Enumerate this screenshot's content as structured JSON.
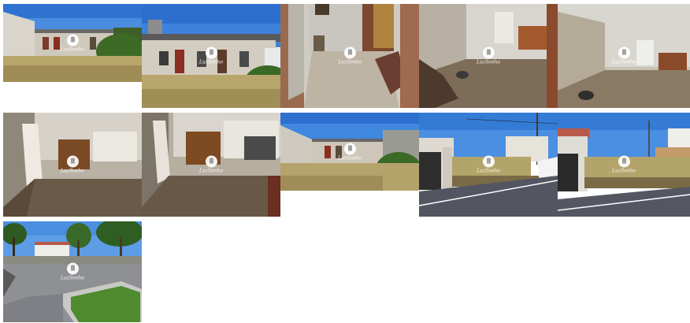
{
  "gallery": {
    "watermark": "LuzSonho",
    "photos": [
      {
        "scene": "exterior-low-building-garden"
      },
      {
        "scene": "exterior-building-front-overgrown"
      },
      {
        "scene": "interior-hallway-door-sofa"
      },
      {
        "scene": "interior-room-cabinets-window"
      },
      {
        "scene": "interior-room-ceiling-tiles-furniture"
      },
      {
        "scene": "interior-room-wardrobe-left-door"
      },
      {
        "scene": "interior-room-wardrobe-wide"
      },
      {
        "scene": "exterior-building-overgrown-lot"
      },
      {
        "scene": "street-gate-vacant-lot"
      },
      {
        "scene": "street-gate-vacant-lot-2"
      },
      {
        "scene": "plaza-with-trees-and-lawn"
      }
    ]
  }
}
